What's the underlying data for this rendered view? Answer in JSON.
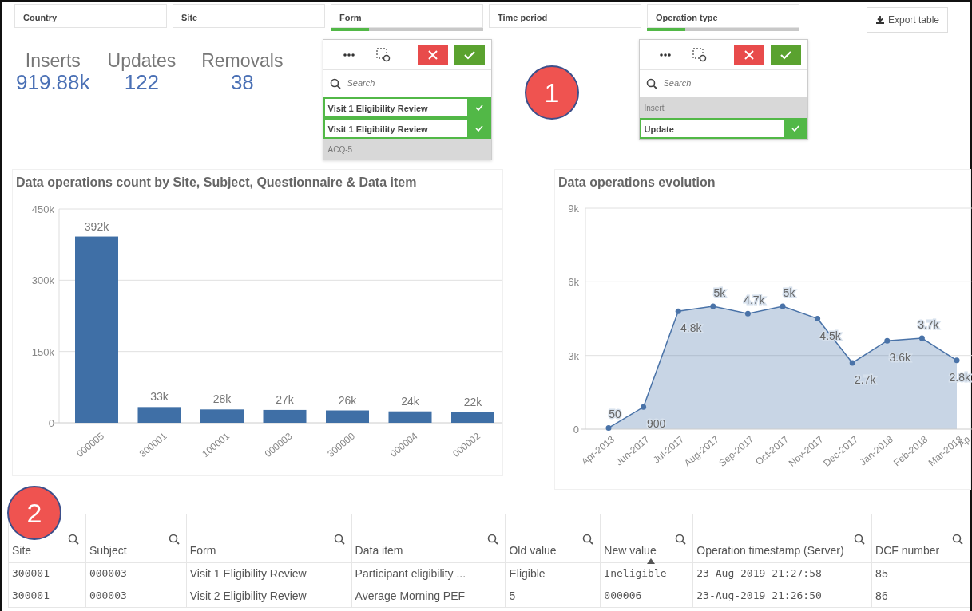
{
  "filters": [
    {
      "label": "Country"
    },
    {
      "label": "Site"
    },
    {
      "label": "Form",
      "level": 0.25,
      "popup": {
        "search_placeholder": "Search",
        "items": [
          {
            "label": "Visit 1 Eligibility Review",
            "selected": true
          },
          {
            "label": "Visit 1 Eligibility Review",
            "selected": true
          },
          {
            "label": "ACQ-5",
            "selected": false
          }
        ]
      }
    },
    {
      "label": "Time period"
    },
    {
      "label": "Operation type",
      "level": 0.25,
      "popup": {
        "search_placeholder": "Search",
        "items": [
          {
            "label": "Insert",
            "selected": false
          },
          {
            "label": "Update",
            "selected": true
          }
        ]
      }
    }
  ],
  "export_button": "Export table",
  "kpis": [
    {
      "label": "Inserts",
      "value": "919.88k"
    },
    {
      "label": "Updates",
      "value": "122"
    },
    {
      "label": "Removals",
      "value": "38"
    }
  ],
  "callouts": [
    "1",
    "2"
  ],
  "bar_panel": {
    "chart_data": {
      "type": "bar",
      "title": "Data operations count by Site, Subject, Questionnaire & Data item",
      "categories": [
        "000005",
        "300001",
        "100001",
        "000003",
        "300000",
        "000004",
        "000002"
      ],
      "series": [
        {
          "color": "#3f6fa6",
          "values": [
            392000,
            33000,
            28000,
            27000,
            26000,
            24000,
            22000
          ]
        }
      ],
      "ylim": [
        0,
        450000
      ],
      "yticks": [
        {
          "value": 0,
          "label": "0"
        },
        {
          "value": 150000,
          "label": "150k"
        },
        {
          "value": 300000,
          "label": "300k"
        },
        {
          "value": 450000,
          "label": "450k"
        }
      ],
      "value_labels": [
        "392k",
        "33k",
        "28k",
        "27k",
        "26k",
        "24k",
        "22k"
      ]
    }
  },
  "line_panel": {
    "chart_data": {
      "type": "area",
      "title": "Data operations evolution",
      "categories": [
        "Apr-2013",
        "Jun-2017",
        "Jul-2017",
        "Aug-2017",
        "Sep-2017",
        "Oct-2017",
        "Nov-2017",
        "Dec-2017",
        "Jan-2018",
        "Feb-2018",
        "Mar-2018",
        "Ap"
      ],
      "series": [
        {
          "color": "#4a73a8",
          "values": [
            50,
            900,
            4800,
            5000,
            4700,
            5000,
            4500,
            2700,
            3600,
            3700,
            2800,
            null
          ]
        }
      ],
      "ylim": [
        0,
        9000
      ],
      "yticks": [
        {
          "value": 0,
          "label": "0"
        },
        {
          "value": 3000,
          "label": "3k"
        },
        {
          "value": 6000,
          "label": "6k"
        },
        {
          "value": 9000,
          "label": "9k"
        }
      ],
      "value_labels": [
        "50",
        "900",
        "4.8k",
        "5k",
        "4.7k",
        "5k",
        "4.5k",
        "2.7k",
        "3.6k",
        "3.7k",
        "2.8k",
        null
      ]
    }
  },
  "table": {
    "columns": [
      {
        "label": "Site",
        "sorted": false
      },
      {
        "label": "Subject",
        "sorted": false
      },
      {
        "label": "Form",
        "sorted": false
      },
      {
        "label": "Data item",
        "sorted": false
      },
      {
        "label": "Old value",
        "sorted": false
      },
      {
        "label": "New value",
        "sorted": true
      },
      {
        "label": "Operation timestamp (Server)",
        "sorted": false
      },
      {
        "label": "DCF number",
        "sorted": false
      }
    ],
    "rows": [
      [
        "300001",
        "000003",
        "Visit 1 Eligibility Review",
        "Participant eligibility ...",
        "Eligible",
        "Ineligible",
        "23-Aug-2019 21:27:58",
        "85"
      ],
      [
        "300001",
        "000003",
        "Visit 2 Eligibility Review",
        "Average Morning PEF",
        "5",
        "000006",
        "23-Aug-2019 21:26:50",
        "86"
      ]
    ]
  }
}
